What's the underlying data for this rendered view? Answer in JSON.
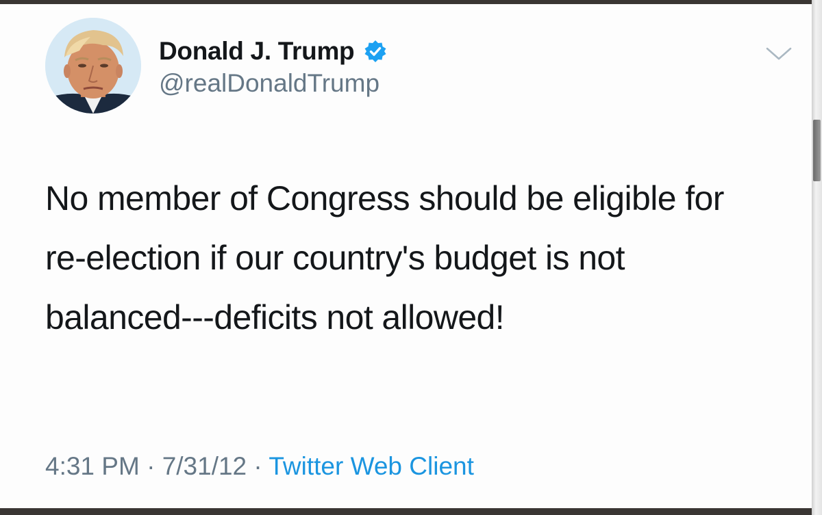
{
  "tweet": {
    "display_name": "Donald J. Trump",
    "handle": "@realDonaldTrump",
    "verified": true,
    "text": "No member of Congress should be eligible for re-election if our country's budget is not balanced---deficits not allowed!",
    "time": "4:31 PM",
    "date": "7/31/12",
    "separator": " · ",
    "source": "Twitter Web Client"
  },
  "icons": {
    "verified": "verified-badge-icon",
    "menu": "chevron-down-icon",
    "avatar": "profile-photo"
  },
  "colors": {
    "text": "#14171a",
    "secondary": "#657786",
    "link": "#1b95e0",
    "verified": "#1da1f2"
  }
}
